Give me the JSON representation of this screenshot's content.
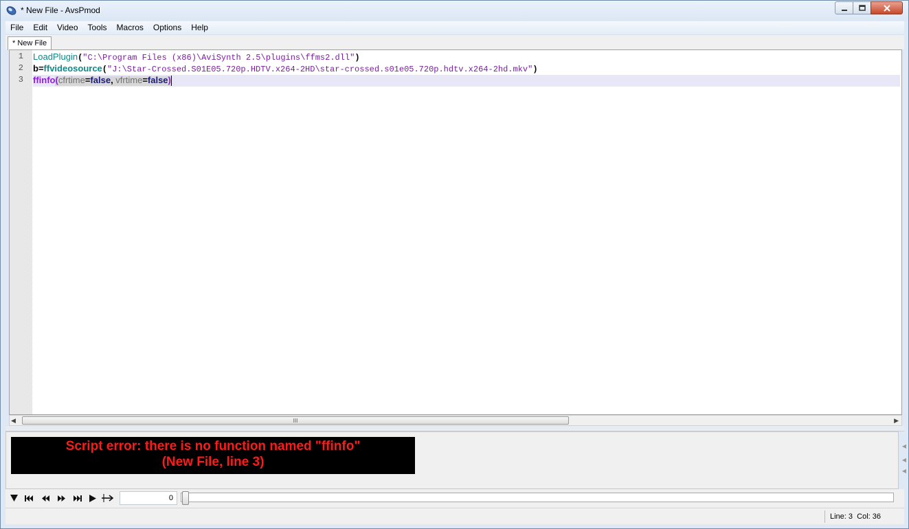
{
  "window": {
    "title": "* New File - AvsPmod"
  },
  "menubar": {
    "items": [
      "File",
      "Edit",
      "Video",
      "Tools",
      "Macros",
      "Options",
      "Help"
    ]
  },
  "tabs": [
    {
      "label": "* New File",
      "active": true
    }
  ],
  "editor": {
    "line_numbers": [
      "1",
      "2",
      "3"
    ],
    "line1": {
      "func": "LoadPlugin",
      "open": "(",
      "string": "\"C:\\Program Files (x86)\\AviSynth 2.5\\plugins\\ffms2.dll\"",
      "close": ")"
    },
    "line2": {
      "var": "b",
      "eq": "=",
      "func": "ffvideosource",
      "open": "(",
      "string": "\"J:\\Star-Crossed.S01E05.720p.HDTV.x264-2HD\\star-crossed.s01e05.720p.hdtv.x264-2hd.mkv\"",
      "close": ")"
    },
    "line3": {
      "func": "ffinfo",
      "open": "(",
      "arg1": "cfrtime",
      "eq1": "=",
      "val1": "false",
      "comma": ",",
      "arg2": " vfrtime",
      "eq2": "=",
      "val2": "false",
      "close": ")"
    },
    "current_line": 3
  },
  "horizontal_scrollbar": {
    "thumb_grip": "III"
  },
  "preview": {
    "error_line1": "Script error: there is no function named \"ffinfo\"",
    "error_line2": "(New File, line 3)"
  },
  "playback": {
    "frame_value": "0"
  },
  "statusbar": {
    "text": "Line: 3  Col: 36"
  },
  "colors": {
    "keyword": "#0b8a8a",
    "string": "#7a1e9e",
    "unknown_function": "#8a1fd6",
    "error_text": "#ff1a1a",
    "current_line_highlight": "#e7e7f8"
  }
}
